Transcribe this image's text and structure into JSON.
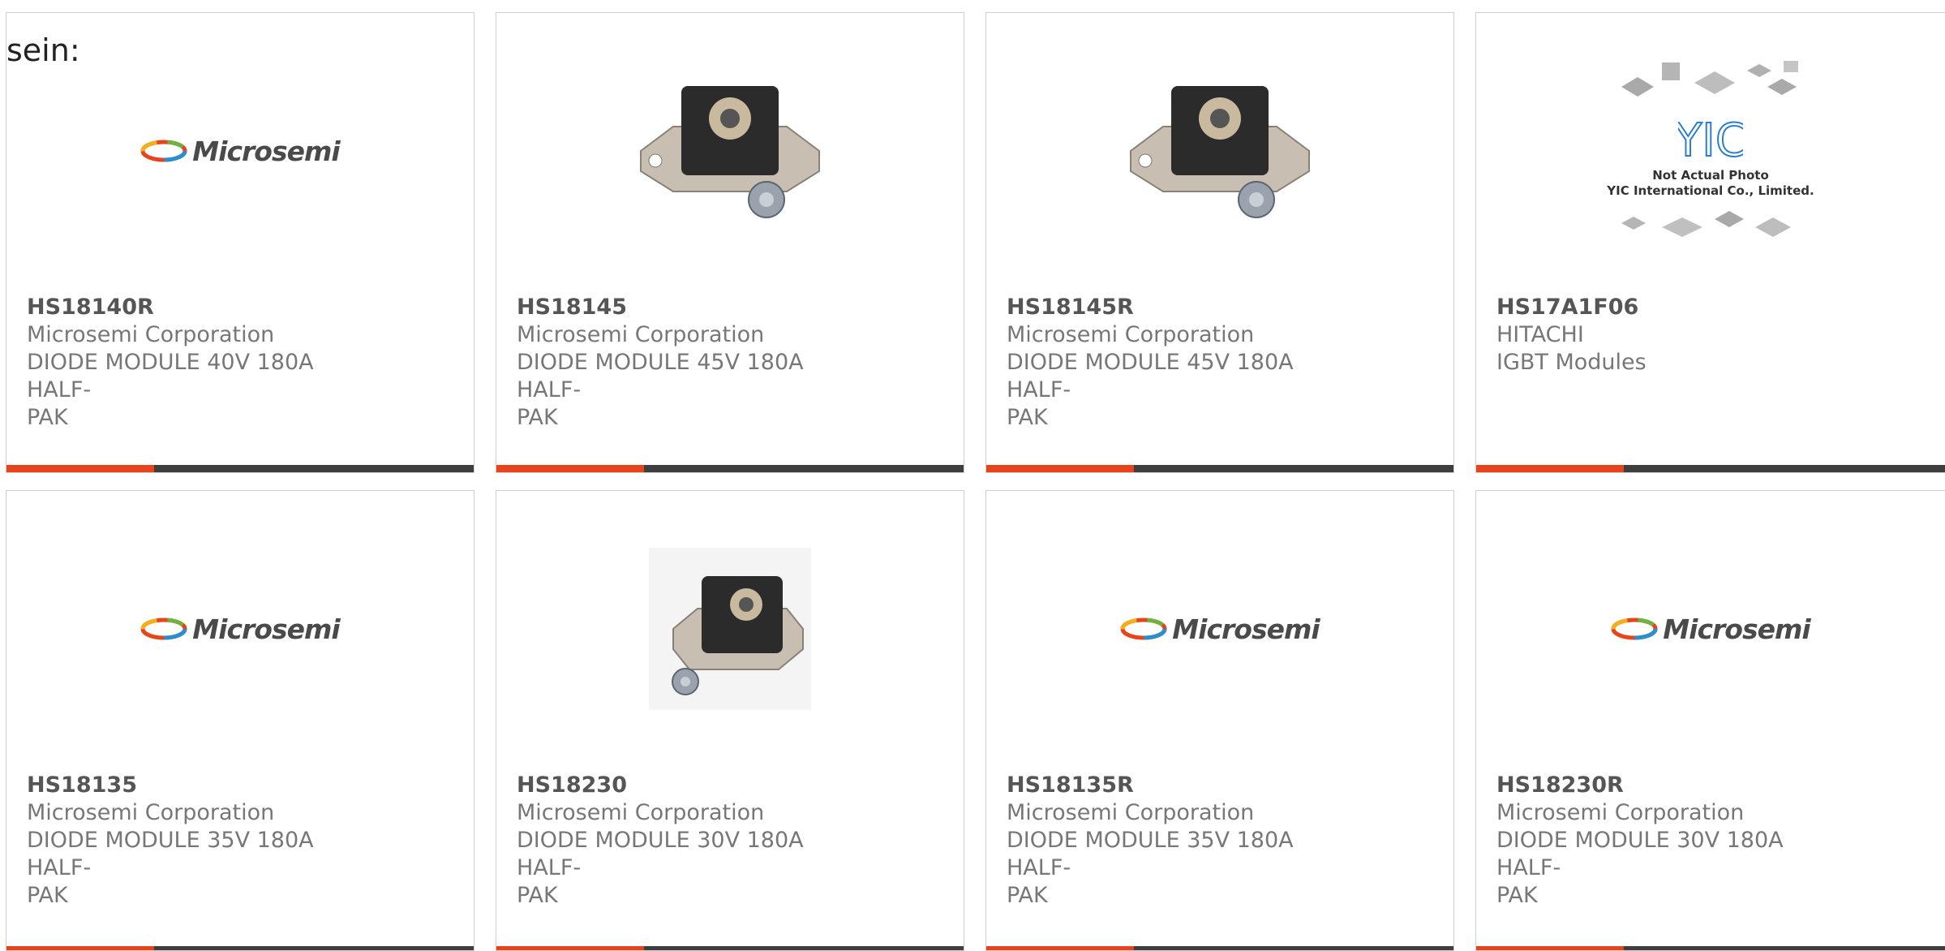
{
  "intro_text": "sein:",
  "accent_color": "#e8441b",
  "products": [
    {
      "part": "HS18140R",
      "maker": "Microsemi Corporation",
      "desc_line1": "DIODE MODULE 40V 180A HALF-",
      "desc_line2": "PAK",
      "image": "microsemi-logo"
    },
    {
      "part": "HS18145",
      "maker": "Microsemi Corporation",
      "desc_line1": "DIODE MODULE 45V 180A HALF-",
      "desc_line2": "PAK",
      "image": "diode-module-photo"
    },
    {
      "part": "HS18145R",
      "maker": "Microsemi Corporation",
      "desc_line1": "DIODE MODULE 45V 180A HALF-",
      "desc_line2": "PAK",
      "image": "diode-module-photo"
    },
    {
      "part": "HS17A1F06",
      "maker": "HITACHI",
      "desc_line1": "IGBT Modules",
      "desc_line2": "",
      "image": "yic-placeholder"
    },
    {
      "part": "HS18135",
      "maker": "Microsemi Corporation",
      "desc_line1": "DIODE MODULE 35V 180A HALF-",
      "desc_line2": "PAK",
      "image": "microsemi-logo"
    },
    {
      "part": "HS18230",
      "maker": "Microsemi Corporation",
      "desc_line1": "DIODE MODULE 30V 180A HALF-",
      "desc_line2": "PAK",
      "image": "diode-module-photo"
    },
    {
      "part": "HS18135R",
      "maker": "Microsemi Corporation",
      "desc_line1": "DIODE MODULE 35V 180A HALF-",
      "desc_line2": "PAK",
      "image": "microsemi-logo"
    },
    {
      "part": "HS18230R",
      "maker": "Microsemi Corporation",
      "desc_line1": "DIODE MODULE 30V 180A HALF-",
      "desc_line2": "PAK",
      "image": "microsemi-logo"
    }
  ],
  "logos": {
    "microsemi": "Microsemi",
    "yic_line1": "Not Actual Photo",
    "yic_line2": "YIC International Co., Limited."
  }
}
